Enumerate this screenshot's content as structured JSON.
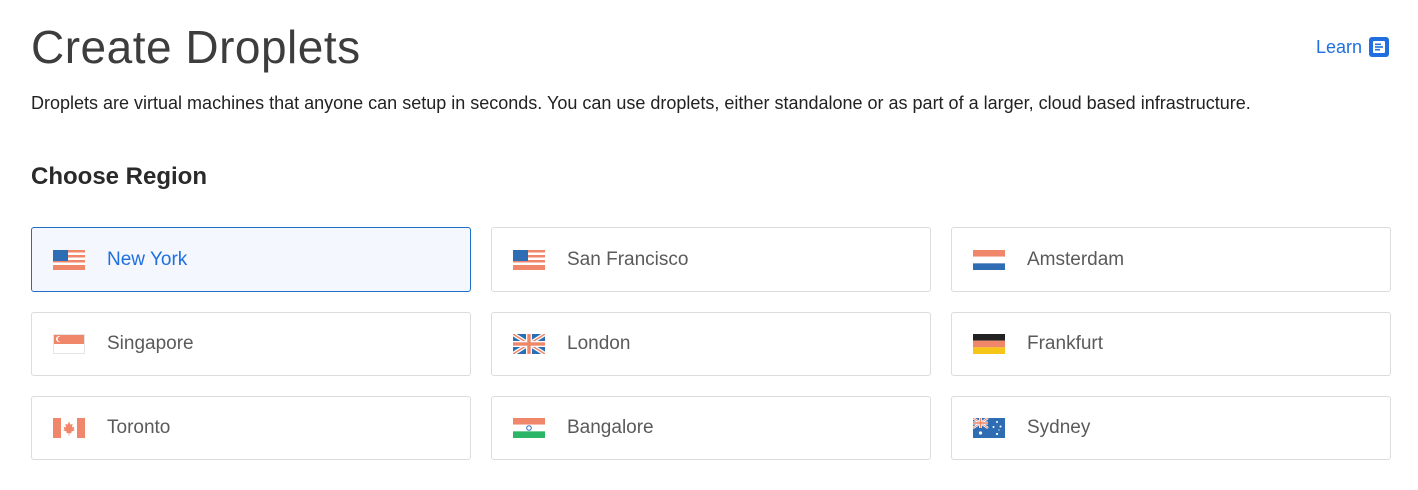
{
  "header": {
    "title": "Create Droplets",
    "learn_label": "Learn"
  },
  "description": "Droplets are virtual machines that anyone can setup in seconds. You can use droplets, either standalone or as part of a larger, cloud based infrastructure.",
  "region_section": {
    "title": "Choose Region",
    "selected": "New York",
    "regions": [
      {
        "label": "New York",
        "flag": "us-flag-icon"
      },
      {
        "label": "San Francisco",
        "flag": "us-flag-icon"
      },
      {
        "label": "Amsterdam",
        "flag": "netherlands-flag-icon"
      },
      {
        "label": "Singapore",
        "flag": "singapore-flag-icon"
      },
      {
        "label": "London",
        "flag": "uk-flag-icon"
      },
      {
        "label": "Frankfurt",
        "flag": "germany-flag-icon"
      },
      {
        "label": "Toronto",
        "flag": "canada-flag-icon"
      },
      {
        "label": "Bangalore",
        "flag": "india-flag-icon"
      },
      {
        "label": "Sydney",
        "flag": "australia-flag-icon"
      }
    ]
  },
  "colors": {
    "accent": "#1f6fe0",
    "selected_border": "#1f6fc4",
    "selected_background": "#f4f7fd",
    "card_border": "#dcdcdc",
    "flag_red": "#f0876a",
    "flag_blue": "#2e6db4",
    "flag_green": "#2bb567",
    "flag_black": "#222222",
    "flag_yellow": "#f5c518"
  }
}
